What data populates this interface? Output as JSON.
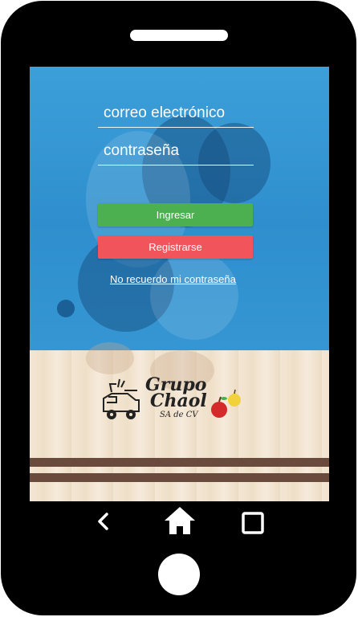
{
  "login": {
    "email_placeholder": "correo electrónico",
    "password_placeholder": "contraseña",
    "login_button": "Ingresar",
    "register_button": "Registrarse",
    "forgot_link": "No recuerdo mi contraseña"
  },
  "logo": {
    "line1": "Grupo",
    "line2": "Chaol",
    "line3": "SA de CV"
  },
  "colors": {
    "login_button": "#4caf50",
    "register_button": "#f2545b",
    "screen_blue": "#3399d6",
    "stripe": "#6b4a3e"
  },
  "navigation": {
    "back_icon": "back-icon",
    "home_icon": "home-icon",
    "recents_icon": "recents-icon"
  }
}
